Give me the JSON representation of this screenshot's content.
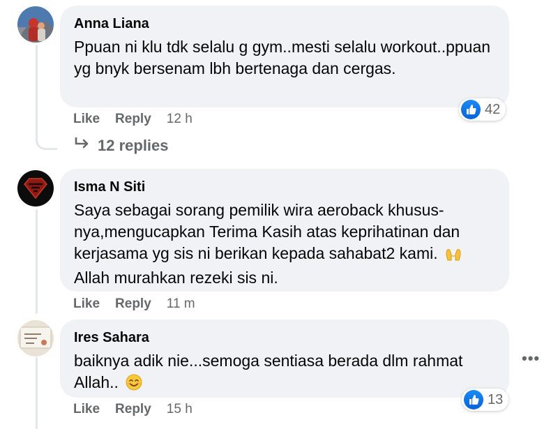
{
  "comments": [
    {
      "author": "Anna Liana",
      "text": "Ppuan ni klu tdk selalu g gym..mesti selalu workout..ppuan yg bnyk bersenam lbh bertenaga dan cergas.",
      "like_label": "Like",
      "reply_label": "Reply",
      "time": "12 h",
      "reaction_icon": "thumbs-up-icon",
      "reaction_count": "42",
      "replies_label": "12 replies"
    },
    {
      "author": "Isma N Siti",
      "text_before": "Saya sebagai sorang pemilik wira aeroback khusus­nya,mengucapkan Terima Kasih atas keprihatinan dan kerjasama yg sis ni berikan kepada sahabat2 kami.",
      "emoji_name": "raising-hands-emoji",
      "text_after": "Allah murahkan rezeki sis ni.",
      "like_label": "Like",
      "reply_label": "Reply",
      "time": "11 m"
    },
    {
      "author": "Ires Sahara",
      "text_before": "baiknya adik nie...semoga sentiasa berada dlm rahmat Allah..",
      "emoji_name": "smiling-face-emoji",
      "like_label": "Like",
      "reply_label": "Reply",
      "time": "15 h",
      "reaction_icon": "thumbs-up-icon",
      "reaction_count": "13",
      "more_label": "•••"
    }
  ],
  "colors": {
    "bubble": "#f0f2f5",
    "secondary_text": "#65676b",
    "like_blue": "#1877f2"
  }
}
